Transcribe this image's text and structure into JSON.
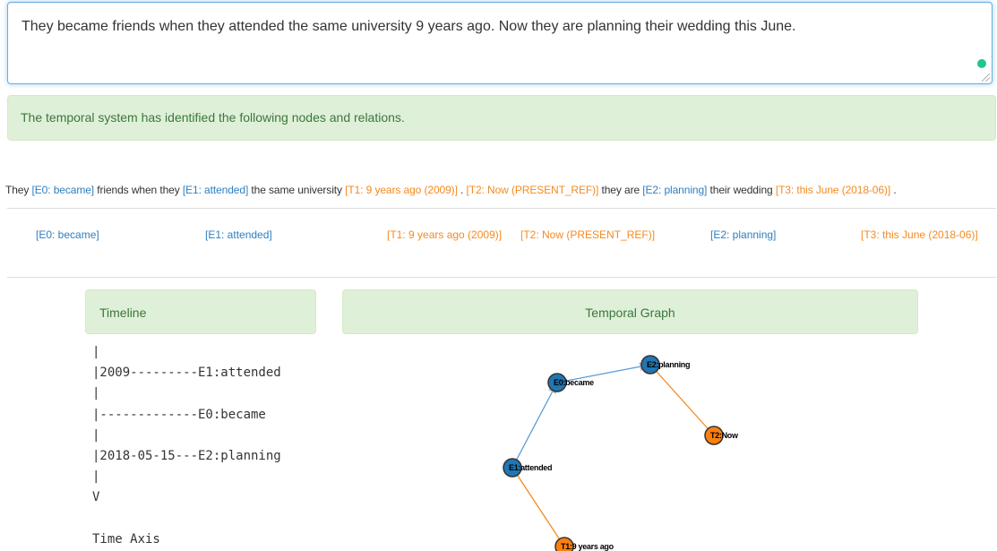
{
  "input": {
    "text": "They became friends when they attended the same university 9 years ago. Now they are planning their wedding this June."
  },
  "alert": {
    "message": "The temporal system has identified the following nodes and relations."
  },
  "annotated_sentence": {
    "segments": [
      {
        "text": "They ",
        "type": "plain"
      },
      {
        "text": "[E0: became]",
        "type": "event"
      },
      {
        "text": " friends when they ",
        "type": "plain"
      },
      {
        "text": "[E1: attended]",
        "type": "event"
      },
      {
        "text": " the same university ",
        "type": "plain"
      },
      {
        "text": "[T1: 9 years ago (2009)]",
        "type": "time"
      },
      {
        "text": " . ",
        "type": "plain"
      },
      {
        "text": "[T2: Now (PRESENT_REF)]",
        "type": "time"
      },
      {
        "text": " they are ",
        "type": "plain"
      },
      {
        "text": "[E2: planning]",
        "type": "event"
      },
      {
        "text": " their wedding ",
        "type": "plain"
      },
      {
        "text": "[T3: this June (2018-06)]",
        "type": "time"
      },
      {
        "text": " .",
        "type": "plain"
      }
    ]
  },
  "node_tags": [
    {
      "label": "[E0: became]",
      "type": "event"
    },
    {
      "label": "[E1: attended]",
      "type": "event"
    },
    {
      "label": "[T1: 9 years ago (2009)]",
      "type": "time"
    },
    {
      "label": "[T2: Now (PRESENT_REF)]",
      "type": "time"
    },
    {
      "label": "[E2: planning]",
      "type": "event"
    },
    {
      "label": "[T3: this June (2018-06)]",
      "type": "time"
    }
  ],
  "timeline": {
    "heading": "Timeline",
    "lines": [
      "|",
      "|2009---------E1:attended",
      "|",
      "|-------------E0:became",
      "|",
      "|2018-05-15---E2:planning",
      "|",
      "V",
      "",
      "Time Axis"
    ]
  },
  "graph": {
    "heading": "Temporal Graph",
    "nodes": [
      {
        "id": "E0",
        "label": "E0:became",
        "type": "event"
      },
      {
        "id": "E2",
        "label": "E2:planning",
        "type": "event"
      },
      {
        "id": "T2",
        "label": "T2:Now",
        "type": "time"
      },
      {
        "id": "E1",
        "label": "E1:attended",
        "type": "event"
      },
      {
        "id": "T1",
        "label": "T1:9 years ago",
        "type": "time"
      }
    ],
    "edges": [
      {
        "from": "E1",
        "to": "E0",
        "kind": "before"
      },
      {
        "from": "E0",
        "to": "E2",
        "kind": "before"
      },
      {
        "from": "E2",
        "to": "T2",
        "kind": "time-link"
      },
      {
        "from": "E1",
        "to": "T1",
        "kind": "time-link"
      }
    ]
  },
  "colors": {
    "event": "#2d7fc1",
    "time": "#f58a1f",
    "event_node": "#1f77b4",
    "time_node": "#ff7f0e",
    "arrow_edge": "#5b9bd5",
    "arrow_head": "#bbbbbb",
    "time_edge": "#f58a1f",
    "alert_bg": "#dff0d8",
    "alert_text": "#3c763d"
  }
}
